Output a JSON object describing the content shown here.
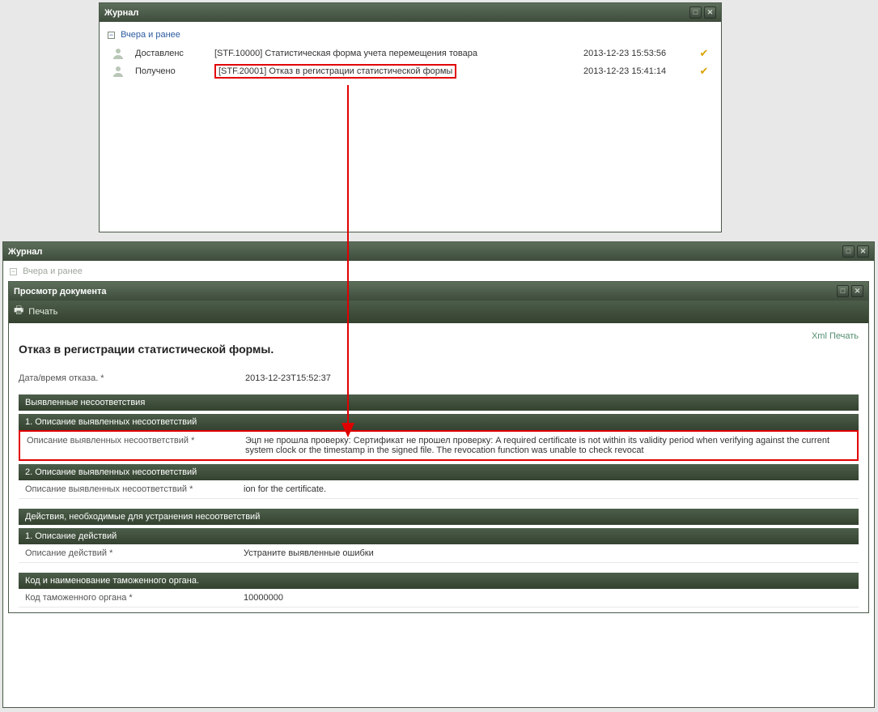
{
  "top_panel": {
    "title": "Журнал",
    "group_label": "Вчера и ранее",
    "rows": [
      {
        "status": "Доставленc",
        "desc": "[STF.10000] Статистическая форма учета перемещения товара",
        "time": "2013-12-23 15:53:56"
      },
      {
        "status": "Получено",
        "desc": "[STF.20001] Отказ в регистрации статистической формы",
        "time": "2013-12-23 15:41:14"
      }
    ]
  },
  "bottom_panel": {
    "title": "Журнал",
    "dimmed_group": "Вчера и ранее",
    "viewer": {
      "title": "Просмотр документа",
      "print_label": "Печать",
      "xml_print": "Xml Печать",
      "doc_title": "Отказ в регистрации статистической формы.",
      "datetime_label": "Дата/время отказа. *",
      "datetime_val": "2013-12-23T15:52:37",
      "discrepancies_header": "Выявленные несоответствия",
      "desc1_header": "1. Описание выявленных несоответствий",
      "desc_field_label": "Описание выявленных несоответствий *",
      "desc1_val": "Эцп не прошла проверку: Сертификат не прошел проверку: A required certificate is not within its validity period when verifying against the current system clock or the timestamp in the signed file. The revocation function was unable to check revocat",
      "desc2_header": "2. Описание выявленных несоответствий",
      "desc2_val": "ion for the certificate.",
      "actions_header": "Действия, необходимые для устранения несоответствий",
      "action1_header": "1. Описание действий",
      "action_field_label": "Описание действий *",
      "action1_val": "Устраните выявленные ошибки",
      "customs_header": "Код и наименование таможенного органа.",
      "customs_field_label": "Код таможенного органа *",
      "customs_val": "10000000"
    }
  }
}
